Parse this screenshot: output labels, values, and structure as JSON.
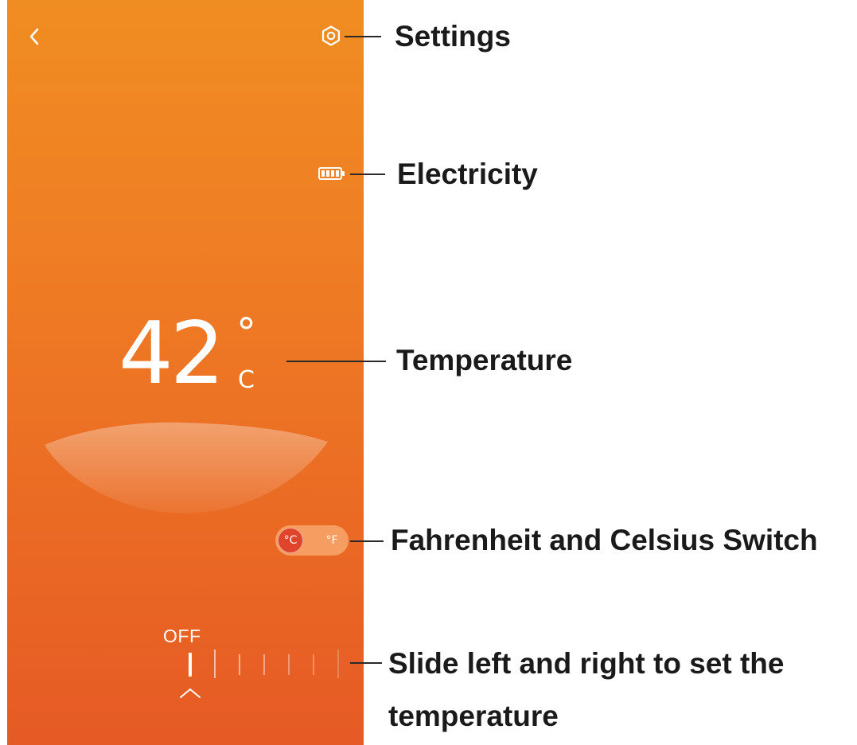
{
  "screen": {
    "background_top": "#f08d22",
    "background_bottom": "#e65a25",
    "back_icon": "chevron-left-icon",
    "settings_icon": "gear-icon",
    "battery_icon": "battery-icon",
    "temperature": {
      "value": "42",
      "degree": "°",
      "unit": "C"
    },
    "unit_switch": {
      "celsius_label": "°C",
      "fahrenheit_label": "°F",
      "selected": "°C",
      "active_color": "#e0442a"
    },
    "slider": {
      "off_label": "OFF",
      "pointer_icon": "caret-up-icon",
      "selected_index": 0
    }
  },
  "annotations": {
    "settings": "Settings",
    "electricity": "Electricity",
    "temperature": "Temperature",
    "unit_switch": "Fahrenheit and Celsius Switch",
    "slider_line1": "Slide left and right to set the",
    "slider_line2": "temperature"
  }
}
